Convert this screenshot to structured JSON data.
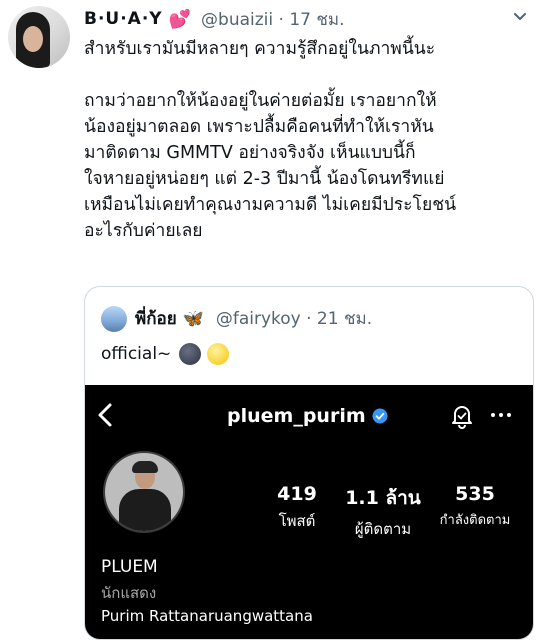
{
  "tweet": {
    "display_name": "B·U·A·Y",
    "handle_time": "@buaizii · 17 ชม.",
    "text": "สำหรับเรามันมีหลายๆ ความรู้สึกอยู่ในภาพนี้นะ\n\nถามว่าอยากให้น้องอยู่ในค่ายต่อมั้ย เราอยากให้\nน้องอยู่มาตลอด เพราะปลื้มคือคนที่ทำให้เราหัน\nมาติดตาม GMMTV อย่างจริงจัง เห็นแบบนี้ก็\nใจหายอยู่หน่อยๆ แต่ 2-3 ปีมานี้ น้องโดนทรีทแย่\nเหมือนไม่เคยทำคุณงามความดี ไม่เคยมีประโยชน์\nอะไรกับค่ายเลย",
    "name_emoji": "heart-emoji"
  },
  "quote": {
    "name": "พี่ก้อย",
    "name_emoji": "butterfly-emoji",
    "handle_time": "@fairykoy · 21 ชม.",
    "text": "official~",
    "text_emojis": [
      "new-moon-face-emoji",
      "full-moon-face-emoji"
    ]
  },
  "instagram": {
    "username": "pluem_purim",
    "stats": [
      {
        "value": "419",
        "label": "โพสต์"
      },
      {
        "value": "1.1 ล้าน",
        "label": "ผู้ติดตาม"
      },
      {
        "value": "535",
        "label": "กำลังติดตาม"
      }
    ],
    "name": "PLUEM",
    "category": "นักแสดง",
    "full_name": "Purim Rattanaruangwattana"
  },
  "colors": {
    "muted": "#536471",
    "border": "#cfd9de",
    "verified": "#3897f0"
  }
}
